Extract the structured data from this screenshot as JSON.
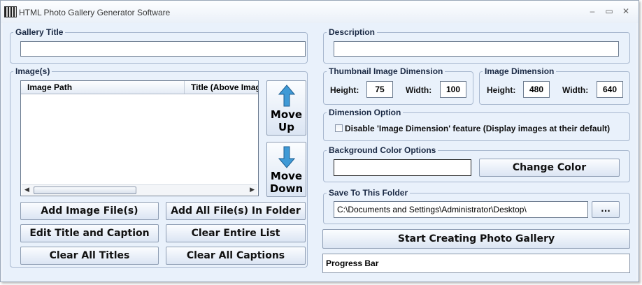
{
  "window": {
    "title": "HTML Photo Gallery Generator Software",
    "controls": {
      "minimize": "–",
      "maximize": "▭",
      "close": "✕"
    }
  },
  "gallery_title": {
    "legend": "Gallery Title",
    "value": ""
  },
  "description": {
    "legend": "Description",
    "value": ""
  },
  "images": {
    "legend": "Image(s)",
    "columns": [
      "Image Path",
      "Title (Above Imag"
    ],
    "rows": [],
    "move_up": [
      "Move",
      "Up"
    ],
    "move_down": [
      "Move",
      "Down"
    ],
    "buttons": {
      "add_image_files": "Add Image File(s)",
      "add_all_files": "Add All File(s) In Folder",
      "edit_title_caption": "Edit Title and Caption",
      "clear_entire_list": "Clear Entire List",
      "clear_all_titles": "Clear All Titles",
      "clear_all_captions": "Clear All Captions"
    }
  },
  "thumbnail_dimension": {
    "legend": "Thumbnail Image Dimension",
    "height_label": "Height:",
    "height": "75",
    "width_label": "Width:",
    "width": "100"
  },
  "image_dimension": {
    "legend": "Image Dimension",
    "height_label": "Height:",
    "height": "480",
    "width_label": "Width:",
    "width": "640"
  },
  "dimension_option": {
    "legend": "Dimension Option",
    "checkbox_label": "Disable 'Image Dimension' feature (Display images at their default)",
    "checked": false
  },
  "background_color": {
    "legend": "Background Color Options",
    "value": "",
    "button": "Change Color"
  },
  "save_folder": {
    "legend": "Save To This Folder",
    "path": "C:\\Documents and Settings\\Administrator\\Desktop\\",
    "browse": "..."
  },
  "start_button": "Start Creating Photo Gallery",
  "progress": {
    "label": "Progress Bar"
  }
}
